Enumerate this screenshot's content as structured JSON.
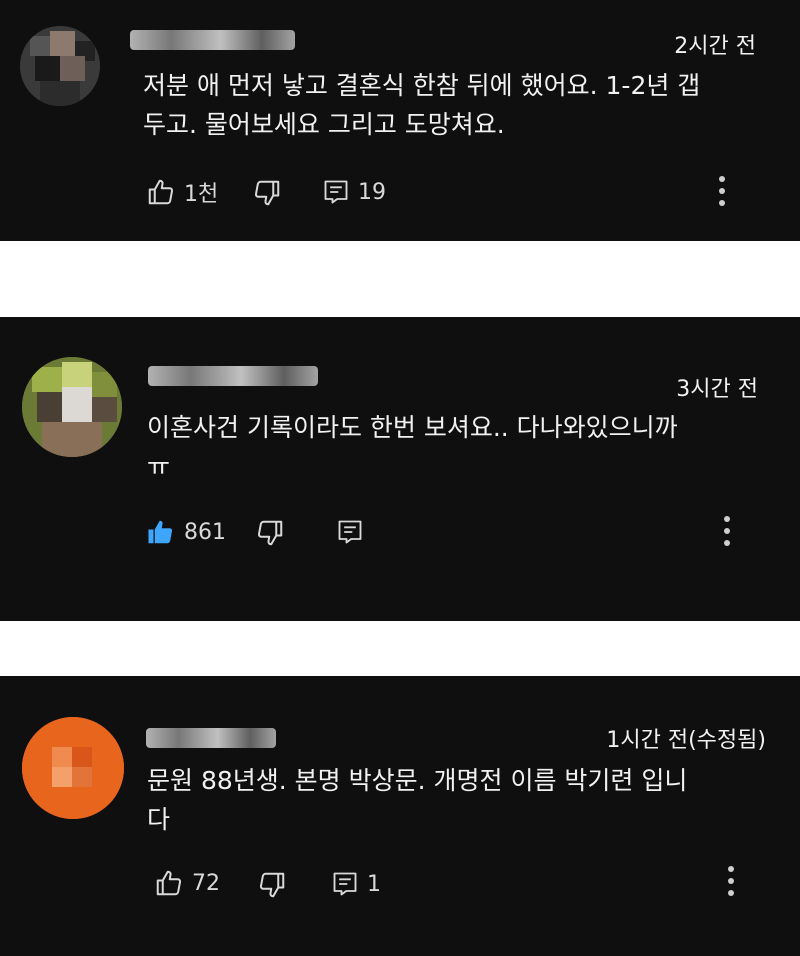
{
  "comments": [
    {
      "time": "2시간 전",
      "lines": [
        "저분 애 먼저 낳고 결혼식 한참 뒤에 했어요. 1-2년 갭",
        "두고. 물어보세요 그리고 도망쳐요."
      ],
      "likes": "1천",
      "replies": "19",
      "liked": false
    },
    {
      "time": "3시간 전",
      "lines": [
        "이혼사건 기록이라도 한번 보셔요.. 다나와있으니까",
        "ㅠ"
      ],
      "likes": "861",
      "replies": "",
      "liked": true
    },
    {
      "time": "1시간 전(수정됨)",
      "lines": [
        "문원 88년생. 본명 박상문. 개명전 이름 박기련 입니",
        "다"
      ],
      "likes": "72",
      "replies": "1",
      "liked": false
    }
  ],
  "colors": {
    "background": "#0f0f0f",
    "separator": "#ffffff",
    "liked_blue": "#3ea6ff",
    "avatar_orange": "#e8651e"
  },
  "icons": [
    "like-icon",
    "dislike-icon",
    "reply-icon",
    "more-options-icon"
  ]
}
